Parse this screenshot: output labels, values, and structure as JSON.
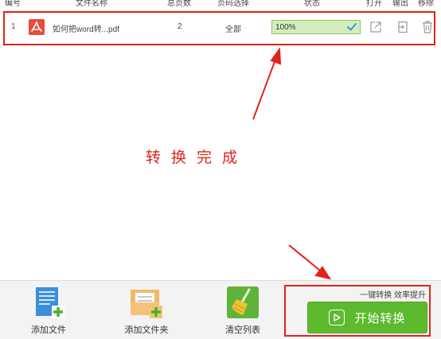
{
  "table": {
    "headers": {
      "index": "编号",
      "file_name": "文件名称",
      "total_pages": "总页数",
      "page_select": "页码选择",
      "status": "状态",
      "open": "打开",
      "export": "输出",
      "remove": "移除"
    },
    "rows": [
      {
        "index": "1",
        "icon": "pdf-icon",
        "file_name": "如何把word转...pdf",
        "total_pages": "2",
        "page_select": "全部",
        "progress_text": "100%",
        "progress_value": 1.0
      }
    ]
  },
  "annotation": {
    "text": "转换完成",
    "color": "#e2231a"
  },
  "toolbar": {
    "add_file_label": "添加文件",
    "add_folder_label": "添加文件夹",
    "clear_list_label": "清空列表",
    "slogan": "一键转换  效率提升",
    "start_label": "开始转换"
  },
  "colors": {
    "accent_green": "#5dba2f",
    "progress_bg": "#e4f4d6",
    "highlight_red": "#e2231a",
    "toolbar_bg": "#f3f3f3"
  }
}
